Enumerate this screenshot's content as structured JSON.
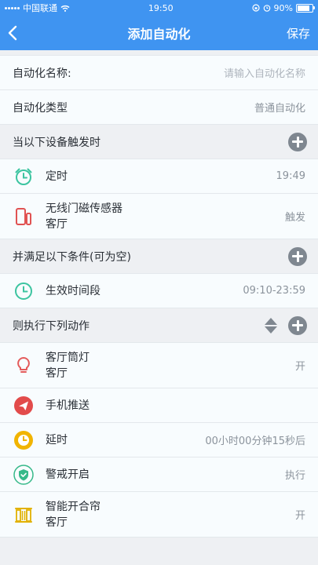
{
  "status": {
    "carrier": "中国联通",
    "time": "19:50",
    "battery": "90%"
  },
  "nav": {
    "title": "添加自动化",
    "save": "保存"
  },
  "form": {
    "name_label": "自动化名称:",
    "name_placeholder": "请输入自动化名称",
    "type_label": "自动化类型",
    "type_value": "普通自动化"
  },
  "triggers": {
    "header": "当以下设备触发时",
    "items": [
      {
        "title": "定时",
        "value": "19:49"
      },
      {
        "title": "无线门磁传感器",
        "sub": "客厅",
        "value": "触发"
      }
    ]
  },
  "conditions": {
    "header": "并满足以下条件(可为空)",
    "items": [
      {
        "title": "生效时间段",
        "value": "09:10-23:59"
      }
    ]
  },
  "actions": {
    "header": "则执行下列动作",
    "items": [
      {
        "title": "客厅筒灯",
        "sub": "客厅",
        "value": "开"
      },
      {
        "title": "手机推送",
        "value": ""
      },
      {
        "title": "延时",
        "value": "00小时00分钟15秒后"
      },
      {
        "title": "警戒开启",
        "value": "执行"
      },
      {
        "title": "智能开合帘",
        "sub": "客厅",
        "value": "开"
      }
    ]
  },
  "colors": {
    "accent": "#3f94f1",
    "clock": "#3cc4a0",
    "sensor": "#e05252",
    "bulb": "#e45a5a",
    "push": "#e24b4b",
    "delay": "#f1b400",
    "shield": "#37b98a",
    "curtain": "#e2b100"
  }
}
